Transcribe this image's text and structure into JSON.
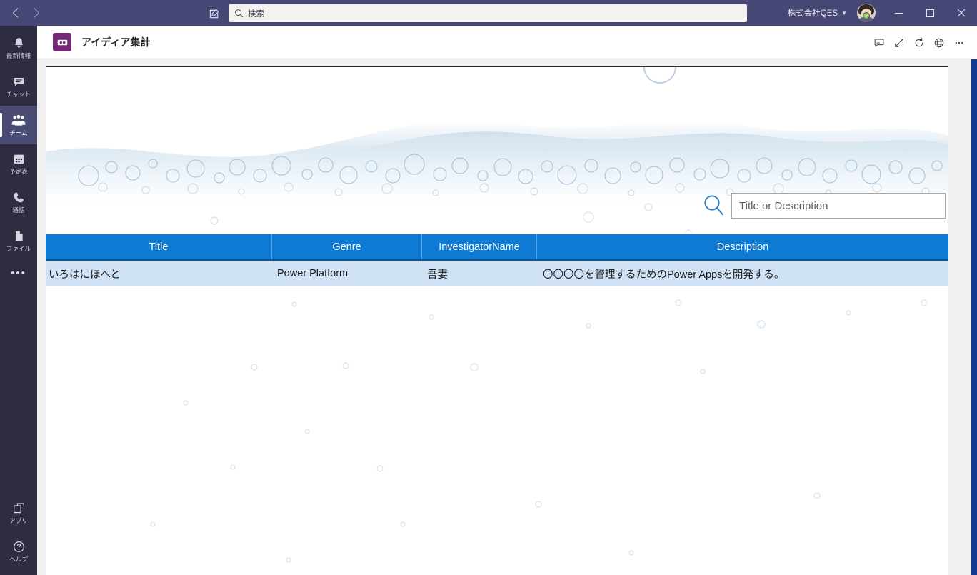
{
  "titlebar": {
    "back_icon": "chevron-left-icon",
    "forward_icon": "chevron-right-icon",
    "compose_icon": "compose-icon",
    "search": {
      "placeholder": "検索",
      "value": "",
      "icon": "search-icon"
    },
    "org_name": "株式会社QES",
    "org_chevron": "chevron-down-icon",
    "avatar": "user-avatar",
    "presence": "available-status",
    "window_controls": {
      "minimize": "–",
      "maximize": "□",
      "close": "✕"
    },
    "background_color": "#464775"
  },
  "rail": {
    "items": [
      {
        "label": "最新情報",
        "icon": "bell-icon",
        "active": false
      },
      {
        "label": "チャット",
        "icon": "chat-icon",
        "active": false
      },
      {
        "label": "チーム",
        "icon": "teams-icon",
        "active": true
      },
      {
        "label": "予定表",
        "icon": "calendar-icon",
        "active": false
      },
      {
        "label": "通話",
        "icon": "phone-icon",
        "active": false
      },
      {
        "label": "ファイル",
        "icon": "file-icon",
        "active": false
      }
    ],
    "more_label": "•••",
    "bottom_items": [
      {
        "label": "アプリ",
        "icon": "apps-icon"
      },
      {
        "label": "ヘルプ",
        "icon": "help-icon"
      }
    ],
    "background_color": "#2d2c41",
    "active_color": "#494b72"
  },
  "app_header": {
    "app_icon": "power-apps-icon",
    "title": "アイディア集計",
    "actions": [
      {
        "name": "feedback-icon",
        "glyph": "chat"
      },
      {
        "name": "collapse-icon",
        "glyph": "collapse"
      },
      {
        "name": "refresh-icon",
        "glyph": "refresh"
      },
      {
        "name": "globe-icon",
        "glyph": "globe"
      },
      {
        "name": "more-options-icon",
        "glyph": "ellipsis"
      }
    ]
  },
  "canvas": {
    "background": "water-splash-bubbles-image",
    "search": {
      "icon": "search-magnifier-icon",
      "placeholder": "Title or Description",
      "value": ""
    },
    "table": {
      "header_color": "#0f7ad4",
      "row_color": "#cfe2f6",
      "columns": [
        "Title",
        "Genre",
        "InvestigatorName",
        "Description"
      ],
      "rows": [
        {
          "Title": "いろはにほへと",
          "Genre": "Power Platform",
          "InvestigatorName": "吾妻",
          "Description": "〇〇〇〇を管理するためのPower Appsを開発する。"
        }
      ]
    }
  },
  "scrollbar": {
    "name": "vertical-scrollbar",
    "color": "#123a8f"
  }
}
